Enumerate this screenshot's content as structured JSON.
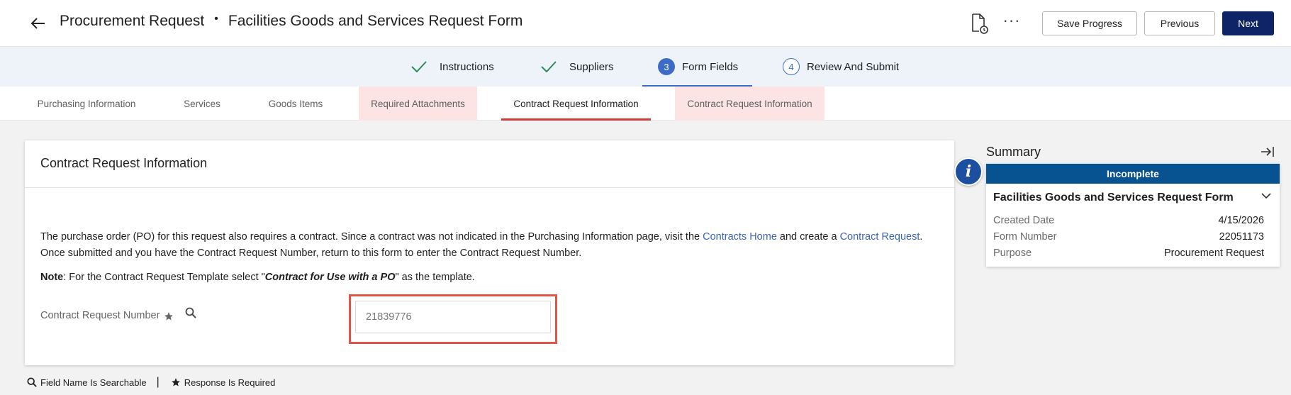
{
  "header": {
    "module": "Procurement Request",
    "separator": "•",
    "form_name": "Facilities Goods and Services Request Form",
    "buttons": {
      "save": "Save Progress",
      "previous": "Previous",
      "next": "Next"
    }
  },
  "steps": [
    {
      "label": "Instructions",
      "state": "done"
    },
    {
      "label": "Suppliers",
      "state": "done"
    },
    {
      "label": "Form Fields",
      "number": "3",
      "state": "active"
    },
    {
      "label": "Review And Submit",
      "number": "4",
      "state": "todo"
    }
  ],
  "tabs": [
    {
      "label": "Purchasing Information",
      "state": "normal"
    },
    {
      "label": "Services",
      "state": "normal"
    },
    {
      "label": "Goods Items",
      "state": "normal"
    },
    {
      "label": "Required Attachments",
      "state": "error"
    },
    {
      "label": "Contract Request Information",
      "state": "selected"
    },
    {
      "label": "Contract Request Information",
      "state": "error"
    }
  ],
  "section": {
    "title": "Contract Request Information",
    "paragraph": {
      "part1": "The purchase order (PO) for this request also requires a contract.  Since a contract was not indicated in the Purchasing Information page, visit the ",
      "link1": "Contracts Home",
      "part2": " and create a ",
      "link2": "Contract Request",
      "part3": ". Once submitted and you have the Contract Request Number, return to this form to enter the Contract Request Number."
    },
    "note": {
      "label": "Note",
      "part1": ": For the Contract Request Template select \"",
      "emphasis": "Contract for Use with a PO",
      "part2": "\" as the template."
    },
    "field": {
      "label": "Contract Request Number",
      "value": "21839776"
    }
  },
  "legend": {
    "searchable": "Field Name Is Searchable",
    "separator": "|",
    "required": "Response Is Required"
  },
  "summary": {
    "title": "Summary",
    "status": "Incomplete",
    "form_name": "Facilities Goods and Services Request Form",
    "rows": [
      {
        "key": "Created Date",
        "value": "4/15/2026"
      },
      {
        "key": "Form Number",
        "value": "22051173"
      },
      {
        "key": "Purpose",
        "value": "Procurement Request"
      }
    ]
  },
  "colors": {
    "primary_navy": "#0f2466",
    "step_blue": "#3c6cc8",
    "status_blue": "#075291",
    "error_tab_bg": "#fce4e4",
    "selected_underline": "#d23a3a",
    "highlight_border": "#e05548",
    "link": "#3a64b8",
    "check_green": "#2e8b57"
  }
}
